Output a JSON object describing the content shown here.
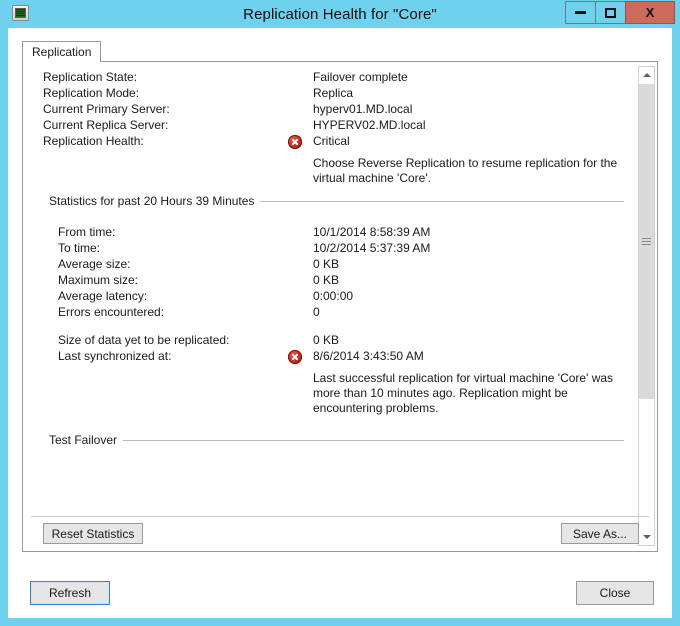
{
  "window": {
    "title": "Replication Health for \"Core\"",
    "icon": "computer-monitor-icon",
    "frame_color": "#6ed2ee",
    "controls": {
      "minimize": "–",
      "maximize": "□",
      "close": "X",
      "close_color": "#cc6a5c"
    }
  },
  "tabs": [
    {
      "label": "Replication",
      "selected": true
    }
  ],
  "report": {
    "summary_rows": [
      {
        "label": "Replication State:",
        "value": "Failover complete"
      },
      {
        "label": "Replication Mode:",
        "value": "Replica"
      },
      {
        "label": "Current Primary Server:",
        "value": "hyperv01.MD.local"
      },
      {
        "label": "Current Replica Server:",
        "value": "HYPERV02.MD.local"
      },
      {
        "label": "Replication Health:",
        "value": "Critical",
        "icon": "error-icon",
        "status_color": "#c0261b"
      }
    ],
    "health_detail": "Choose Reverse Replication to resume replication for the virtual machine 'Core'.",
    "statistics_group_title": "Statistics for past 20 Hours 39 Minutes",
    "statistics_rows": [
      {
        "label": "From time:",
        "value": "10/1/2014 8:58:39 AM"
      },
      {
        "label": "To time:",
        "value": "10/2/2014 5:37:39 AM"
      },
      {
        "label": "Average size:",
        "value": "0 KB"
      },
      {
        "label": "Maximum size:",
        "value": "0 KB"
      },
      {
        "label": "Average latency:",
        "value": "0:00:00"
      },
      {
        "label": "Errors encountered:",
        "value": "0"
      }
    ],
    "pending_rows": [
      {
        "label": "Size of data yet to be replicated:",
        "value": "0 KB"
      },
      {
        "label": "Last synchronized at:",
        "value": "8/6/2014 3:43:50 AM",
        "icon": "error-icon",
        "status_color": "#c0261b"
      }
    ],
    "sync_detail": "Last successful replication for virtual machine 'Core' was more than 10 minutes ago. Replication might be encountering problems.",
    "test_failover_group_title": "Test Failover"
  },
  "scrollbar": {
    "up_arrow": "scroll-up-arrow",
    "down_arrow": "scroll-down-arrow",
    "thumb": "scroll-thumb"
  },
  "buttons": {
    "reset_statistics": "Reset Statistics",
    "save_as": "Save As...",
    "refresh": "Refresh",
    "close": "Close"
  }
}
